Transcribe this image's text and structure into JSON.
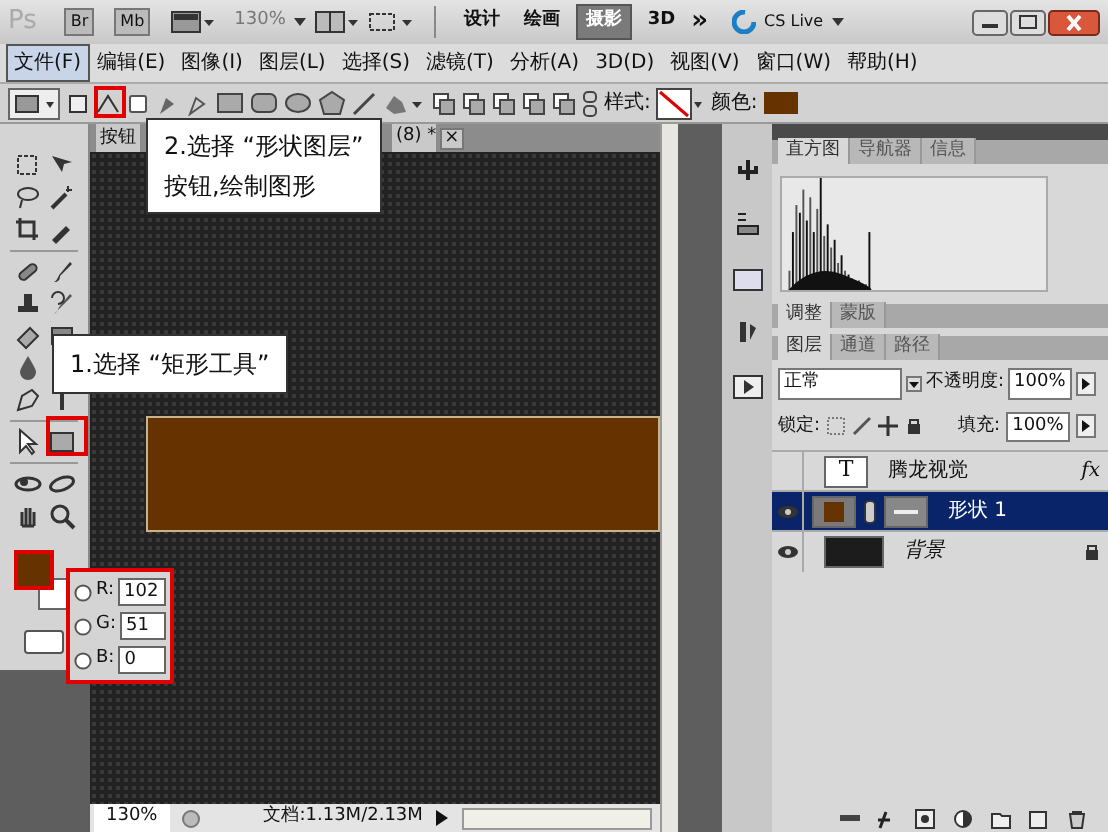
{
  "app": {
    "logo": "Ps",
    "bridge": "Br",
    "mini_bridge": "Mb",
    "zoom": "130%",
    "more": "»",
    "cs_live": "CS Live",
    "workspaces": [
      {
        "label": "设计",
        "selected": false
      },
      {
        "label": "绘画",
        "selected": false
      },
      {
        "label": "摄影",
        "selected": true
      },
      {
        "label": "3D",
        "selected": false
      }
    ]
  },
  "menu": [
    {
      "label": "文件(F)",
      "selected": true
    },
    {
      "label": "编辑(E)",
      "selected": false
    },
    {
      "label": "图像(I)",
      "selected": false
    },
    {
      "label": "图层(L)",
      "selected": false
    },
    {
      "label": "选择(S)",
      "selected": false
    },
    {
      "label": "滤镜(T)",
      "selected": false
    },
    {
      "label": "分析(A)",
      "selected": false
    },
    {
      "label": "3D(D)",
      "selected": false
    },
    {
      "label": "视图(V)",
      "selected": false
    },
    {
      "label": "窗口(W)",
      "selected": false
    },
    {
      "label": "帮助(H)",
      "selected": false
    }
  ],
  "options": {
    "style_label": "样式:",
    "color_label": "颜色:"
  },
  "document_tab": {
    "title": "按钮",
    "suffix": "(8) *",
    "close": "×"
  },
  "status": {
    "zoom": "130%",
    "doc": "文档:1.13M/2.13M"
  },
  "color_picker": {
    "fields": [
      {
        "label": "R:",
        "value": "102",
        "selected": false
      },
      {
        "label": "G:",
        "value": "51",
        "selected": false
      },
      {
        "label": "B:",
        "value": "0",
        "selected": false
      }
    ]
  },
  "panels": {
    "histogram_tabs": [
      {
        "label": "直方图",
        "selected": true
      },
      {
        "label": "导航器",
        "selected": false
      },
      {
        "label": "信息",
        "selected": false
      }
    ],
    "adjust_tabs": [
      {
        "label": "调整",
        "selected": true
      },
      {
        "label": "蒙版",
        "selected": false
      }
    ],
    "layers_tabs": [
      {
        "label": "图层",
        "selected": true
      },
      {
        "label": "通道",
        "selected": false
      },
      {
        "label": "路径",
        "selected": false
      }
    ]
  },
  "layers": {
    "blend_mode": "正常",
    "opacity_label": "不透明度:",
    "opacity": "100%",
    "lock_label": "锁定:",
    "fill_label": "填充:",
    "fill": "100%",
    "items": [
      {
        "name": "腾龙视觉",
        "kind": "text",
        "thumb": "T",
        "fx": "fx",
        "selected": false,
        "visible": false
      },
      {
        "name": "形状 1",
        "kind": "shape",
        "selected": true,
        "visible": true
      },
      {
        "name": "背景",
        "kind": "background",
        "selected": false,
        "visible": true,
        "locked": true
      }
    ]
  },
  "callouts": [
    {
      "lines": [
        "2.选择 “形状图层”",
        "按钮,绘制图形"
      ]
    },
    {
      "lines": [
        "1.选择 “矩形工具”"
      ]
    }
  ]
}
